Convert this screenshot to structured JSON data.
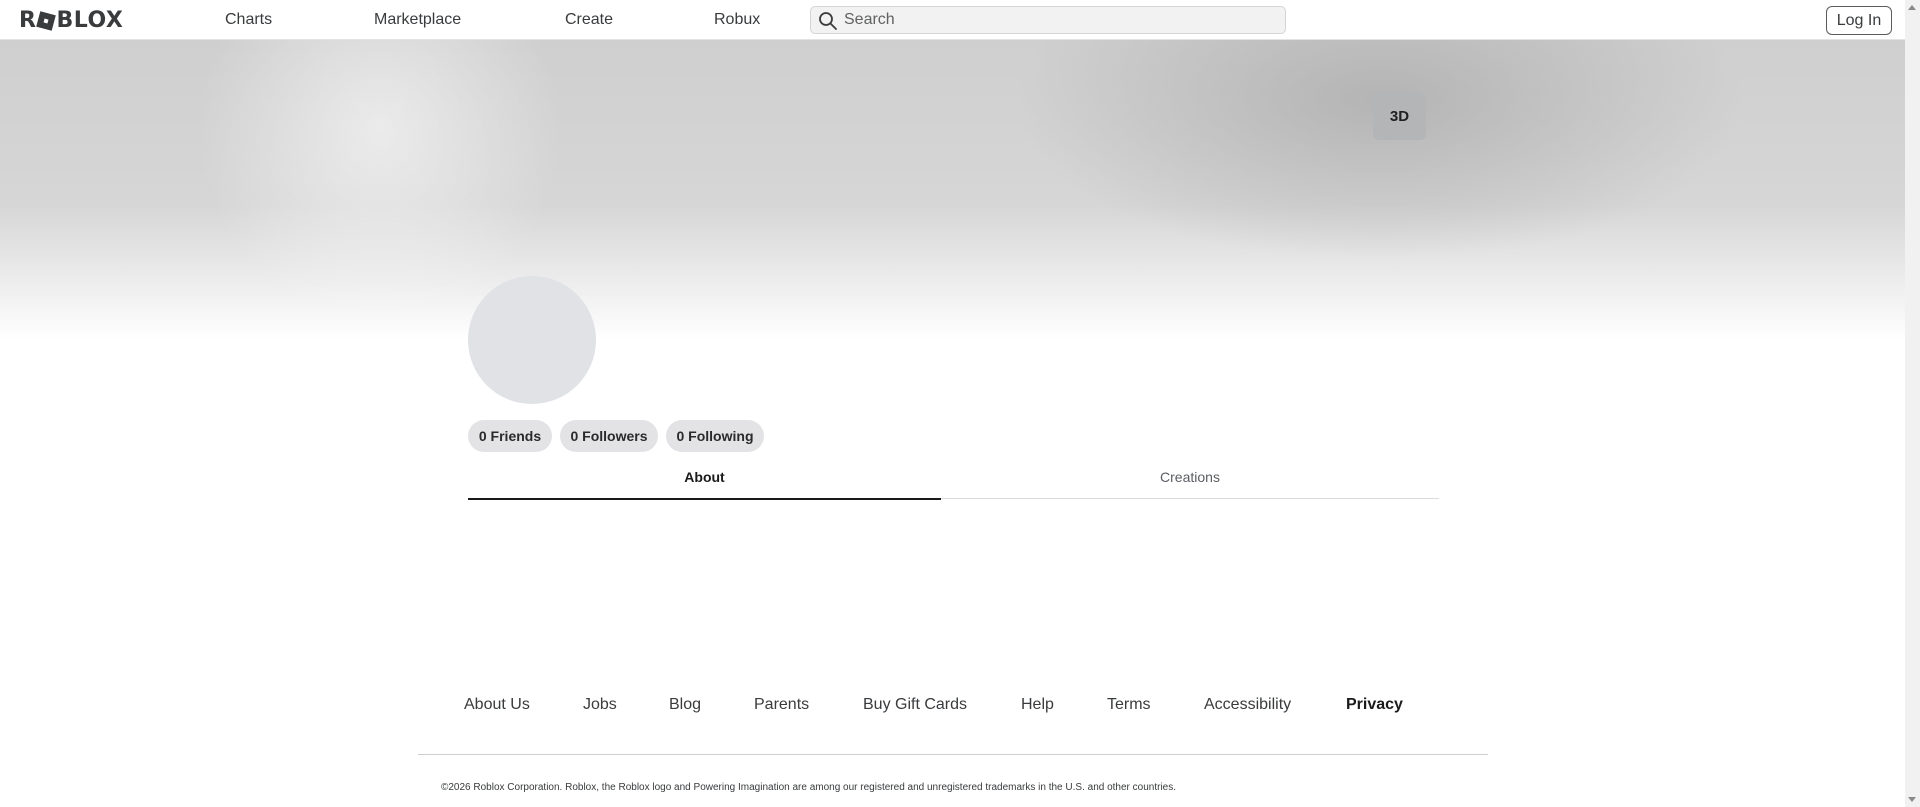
{
  "header": {
    "logo_text": "ROBLOX",
    "nav": {
      "charts": "Charts",
      "marketplace": "Marketplace",
      "create": "Create",
      "robux": "Robux"
    },
    "search": {
      "placeholder": "Search",
      "icon": "search-icon"
    },
    "login_label": "Log In"
  },
  "banner": {
    "view_3d_label": "3D"
  },
  "profile": {
    "stats": {
      "friends": "0 Friends",
      "followers": "0 Followers",
      "following": "0 Following"
    },
    "tabs": {
      "about": "About",
      "creations": "Creations",
      "active": "About"
    }
  },
  "footer": {
    "links": {
      "about_us": "About Us",
      "jobs": "Jobs",
      "blog": "Blog",
      "parents": "Parents",
      "gift_cards": "Buy Gift Cards",
      "help": "Help",
      "terms": "Terms",
      "accessibility": "Accessibility",
      "privacy": "Privacy"
    },
    "copyright": "©2026 Roblox Corporation. Roblox, the Roblox logo and Powering Imagination are among our registered and unregistered trademarks in the U.S. and other countries."
  },
  "colors": {
    "text_primary": "#393b3d",
    "banner_gray": "#cfcfcf",
    "pill_bg": "#e3e3e6",
    "avatar_bg": "#e1e2e6"
  }
}
